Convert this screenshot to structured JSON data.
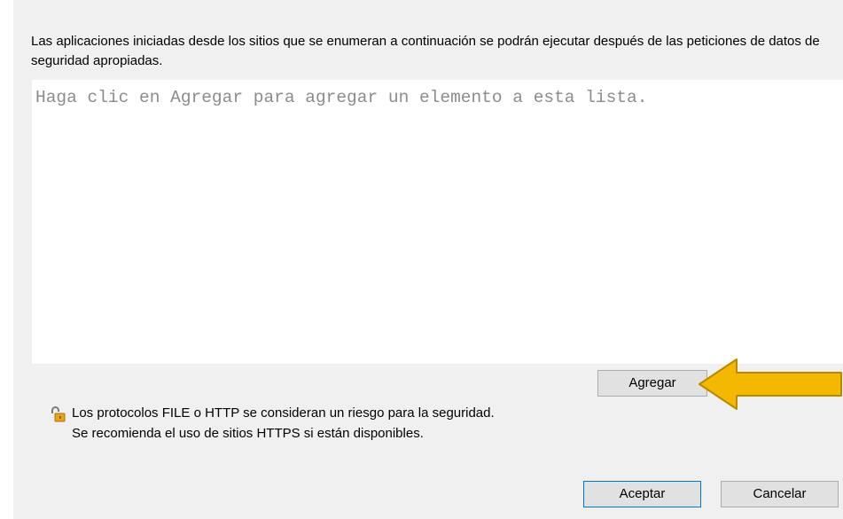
{
  "description": "Las aplicaciones iniciadas desde los sitios que se enumeran a continuación se podrán ejecutar después de las peticiones de datos de seguridad apropiadas.",
  "site_list": {
    "placeholder": "Haga clic en Agregar para agregar un elemento a esta lista."
  },
  "buttons": {
    "add": "Agregar",
    "ok": "Aceptar",
    "cancel": "Cancelar"
  },
  "warning": {
    "line1": "Los protocolos FILE o HTTP se consideran un riesgo para la seguridad.",
    "line2": "Se recomienda el uso de sitios HTTPS si están disponibles.",
    "icon": "unlocked-padlock-icon"
  },
  "annotation": {
    "icon": "arrow-left-icon",
    "color": "#f5b800"
  }
}
